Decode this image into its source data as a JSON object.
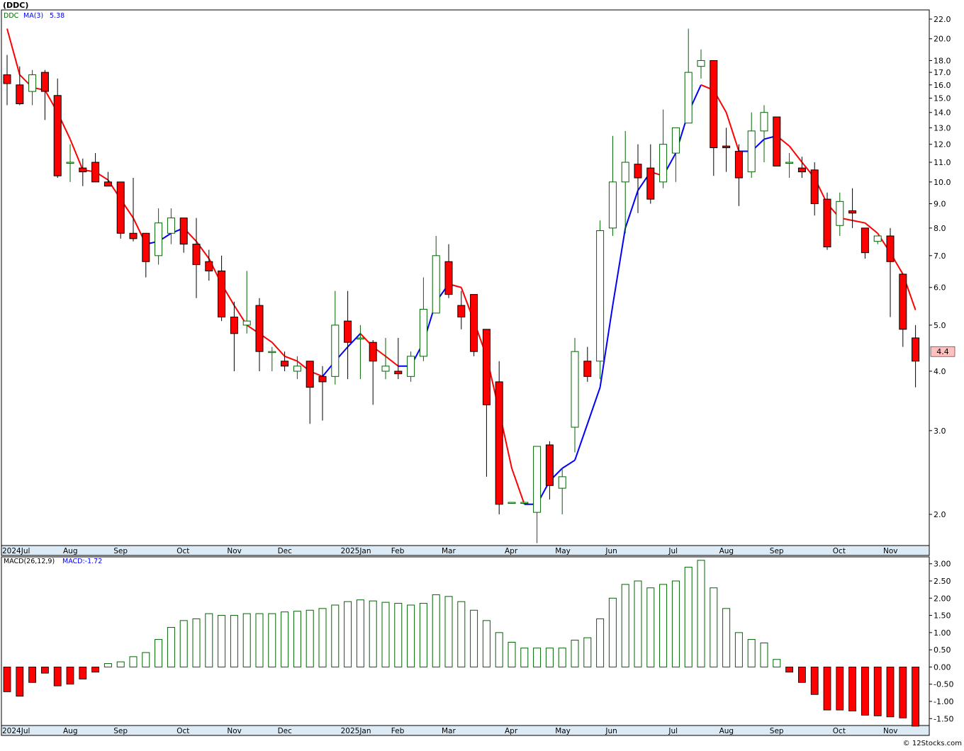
{
  "title": "(DDC)",
  "legend": {
    "ticker": "DDC",
    "ma_label": "MA(3)",
    "ma_value": "5.38"
  },
  "macd_legend": {
    "params": "MACD(26,12,9)",
    "value": "MACD:-1.72"
  },
  "last_price_label": "4.4",
  "watermark": "© 12Stocks.com",
  "colors": {
    "up": "#006400",
    "down": "#ff0000",
    "ma_up": "#0000ff",
    "ma_down": "#ff0000",
    "grid": "#a0a0a0",
    "axis_bar": "#dbeaf5"
  },
  "chart_data": [
    {
      "type": "candlestick",
      "scale": "log",
      "ylim": [
        1.72,
        23.0
      ],
      "y_ticks": [
        "2.0",
        "3.0",
        "4.0",
        "5.0",
        "6.0",
        "7.0",
        "8.0",
        "9.0",
        "10.0",
        "11.0",
        "12.0",
        "13.0",
        "14.0",
        "15.0",
        "16.0",
        "17.0",
        "18.0",
        "20.0",
        "22.0"
      ],
      "x_labels": [
        {
          "label": "2024Jul",
          "week": 0
        },
        {
          "label": "Aug",
          "week": 5
        },
        {
          "label": "Sep",
          "week": 9
        },
        {
          "label": "Oct",
          "week": 14
        },
        {
          "label": "Nov",
          "week": 18
        },
        {
          "label": "Dec",
          "week": 22
        },
        {
          "label": "2025Jan",
          "week": 27
        },
        {
          "label": "Feb",
          "week": 31
        },
        {
          "label": "Mar",
          "week": 35
        },
        {
          "label": "Apr",
          "week": 40
        },
        {
          "label": "May",
          "week": 44
        },
        {
          "label": "Jun",
          "week": 48
        },
        {
          "label": "Jul",
          "week": 53
        },
        {
          "label": "Aug",
          "week": 57
        },
        {
          "label": "Sep",
          "week": 61
        },
        {
          "label": "Oct",
          "week": 66
        },
        {
          "label": "Nov",
          "week": 70
        }
      ],
      "candles": [
        [
          16.8,
          18.5,
          14.5,
          16.1
        ],
        [
          16.0,
          17.5,
          14.5,
          14.6
        ],
        [
          15.5,
          17.2,
          14.5,
          16.8
        ],
        [
          17.0,
          17.2,
          13.5,
          15.5
        ],
        [
          15.2,
          16.5,
          10.2,
          10.3
        ],
        [
          11.0,
          12.0,
          10.0,
          11.0
        ],
        [
          10.7,
          11.2,
          9.8,
          10.5
        ],
        [
          11.0,
          11.5,
          10.0,
          10.0
        ],
        [
          10.0,
          10.5,
          9.8,
          9.8
        ],
        [
          10.0,
          10.0,
          7.6,
          7.8
        ],
        [
          7.8,
          10.2,
          7.5,
          7.6
        ],
        [
          7.8,
          7.8,
          6.3,
          6.8
        ],
        [
          7.0,
          8.8,
          6.7,
          8.2
        ],
        [
          7.8,
          8.8,
          7.4,
          8.4
        ],
        [
          8.4,
          8.4,
          7.1,
          7.4
        ],
        [
          7.4,
          8.4,
          5.7,
          6.7
        ],
        [
          6.8,
          7.2,
          6.2,
          6.5
        ],
        [
          6.5,
          7.0,
          5.1,
          5.2
        ],
        [
          5.2,
          5.6,
          4.0,
          4.8
        ],
        [
          5.0,
          6.5,
          4.8,
          5.1
        ],
        [
          5.5,
          5.7,
          4.0,
          4.4
        ],
        [
          4.4,
          4.5,
          4.0,
          4.4
        ],
        [
          4.2,
          4.4,
          4.0,
          4.1
        ],
        [
          4.0,
          4.3,
          3.85,
          4.1
        ],
        [
          4.2,
          4.2,
          3.1,
          3.7
        ],
        [
          3.9,
          4.1,
          3.15,
          3.8
        ],
        [
          3.9,
          5.9,
          3.75,
          5.0
        ],
        [
          5.1,
          5.9,
          3.85,
          4.6
        ],
        [
          4.7,
          5.0,
          3.85,
          4.7
        ],
        [
          4.6,
          4.65,
          3.4,
          4.2
        ],
        [
          4.0,
          4.7,
          3.85,
          4.1
        ],
        [
          4.0,
          4.7,
          3.85,
          3.95
        ],
        [
          3.9,
          4.4,
          3.8,
          4.3
        ],
        [
          4.3,
          6.3,
          4.2,
          5.4
        ],
        [
          5.3,
          7.7,
          5.3,
          7.0
        ],
        [
          6.8,
          7.4,
          5.7,
          5.8
        ],
        [
          5.5,
          5.9,
          4.9,
          5.2
        ],
        [
          5.8,
          5.8,
          4.3,
          4.4
        ],
        [
          4.9,
          4.9,
          2.4,
          3.4
        ],
        [
          3.8,
          4.2,
          2.0,
          2.1
        ],
        [
          2.12,
          2.12,
          2.12,
          2.12
        ],
        [
          2.12,
          2.12,
          2.1,
          2.12
        ],
        [
          2.02,
          2.78,
          1.74,
          2.78
        ],
        [
          2.8,
          2.85,
          2.15,
          2.3
        ],
        [
          2.27,
          2.5,
          2.0,
          2.4
        ],
        [
          3.05,
          4.7,
          2.7,
          4.4
        ],
        [
          4.2,
          4.5,
          3.8,
          3.9
        ],
        [
          4.2,
          8.3,
          3.85,
          7.9
        ],
        [
          8.0,
          12.5,
          7.7,
          10.0
        ],
        [
          10.0,
          12.8,
          7.8,
          11.0
        ],
        [
          10.9,
          12.0,
          8.6,
          10.2
        ],
        [
          10.7,
          12.0,
          9.0,
          9.2
        ],
        [
          10.0,
          14.2,
          9.7,
          12.0
        ],
        [
          11.5,
          13.0,
          10.0,
          13.0
        ],
        [
          13.3,
          21.0,
          13.3,
          17.0
        ],
        [
          17.5,
          19.0,
          16.5,
          18.0
        ],
        [
          18.0,
          18.0,
          10.3,
          11.8
        ],
        [
          11.9,
          13.0,
          10.5,
          11.8
        ],
        [
          11.6,
          12.0,
          8.9,
          10.2
        ],
        [
          10.5,
          14.0,
          10.2,
          12.8
        ],
        [
          12.8,
          14.5,
          11.0,
          14.0
        ],
        [
          13.7,
          13.7,
          10.8,
          10.8
        ],
        [
          11.0,
          11.5,
          10.2,
          11.0
        ],
        [
          10.7,
          11.3,
          10.2,
          10.5
        ],
        [
          10.6,
          11.0,
          8.5,
          9.0
        ],
        [
          9.2,
          9.5,
          7.2,
          7.3
        ],
        [
          8.1,
          9.5,
          7.7,
          9.1
        ],
        [
          8.7,
          9.7,
          8.0,
          8.6
        ],
        [
          8.0,
          8.0,
          6.9,
          7.1
        ],
        [
          7.5,
          7.7,
          7.4,
          7.7
        ],
        [
          7.7,
          8.0,
          5.2,
          6.8
        ],
        [
          6.4,
          6.4,
          4.5,
          4.9
        ],
        [
          4.7,
          5.0,
          3.7,
          4.2
        ]
      ],
      "ma3": [
        21.0,
        16.8,
        15.8,
        15.6,
        14.0,
        12.3,
        10.6,
        10.5,
        10.1,
        9.2,
        8.4,
        7.4,
        7.5,
        7.8,
        8.0,
        7.5,
        6.9,
        6.1,
        5.5,
        5.0,
        4.8,
        4.6,
        4.3,
        4.2,
        4.0,
        3.9,
        4.2,
        4.5,
        4.8,
        4.5,
        4.3,
        4.1,
        4.1,
        4.6,
        5.6,
        6.1,
        6.0,
        5.1,
        4.3,
        3.3,
        2.5,
        2.1,
        2.1,
        2.35,
        2.5,
        2.6,
        3.1,
        3.7,
        5.5,
        8.0,
        9.6,
        10.5,
        10.3,
        11.5,
        14.0,
        16.0,
        15.6,
        14.0,
        11.6,
        11.6,
        12.3,
        12.5,
        11.9,
        11.0,
        10.2,
        9.0,
        8.4,
        8.3,
        8.2,
        7.8,
        7.1,
        6.4,
        5.38
      ],
      "macd_ylim": [
        -1.7,
        3.2
      ],
      "macd_ticks": [
        "3.00",
        "2.50",
        "2.00",
        "1.50",
        "1.00",
        "0.50",
        "0.00",
        "-0.50",
        "-1.00",
        "-1.50"
      ],
      "macd": [
        -0.72,
        -0.85,
        -0.45,
        -0.18,
        -0.55,
        -0.5,
        -0.35,
        -0.15,
        0.1,
        0.15,
        0.3,
        0.42,
        0.8,
        1.15,
        1.35,
        1.4,
        1.55,
        1.5,
        1.5,
        1.55,
        1.55,
        1.55,
        1.6,
        1.62,
        1.65,
        1.7,
        1.8,
        1.9,
        1.95,
        1.92,
        1.88,
        1.85,
        1.8,
        1.85,
        2.1,
        2.05,
        1.9,
        1.65,
        1.35,
        1.0,
        0.72,
        0.55,
        0.55,
        0.55,
        0.55,
        0.78,
        0.85,
        1.4,
        2.0,
        2.4,
        2.5,
        2.3,
        2.4,
        2.5,
        2.9,
        3.1,
        2.3,
        1.7,
        1.0,
        0.8,
        0.7,
        0.22,
        -0.15,
        -0.45,
        -0.8,
        -1.25,
        -1.25,
        -1.28,
        -1.4,
        -1.42,
        -1.45,
        -1.48,
        -1.72
      ]
    }
  ]
}
